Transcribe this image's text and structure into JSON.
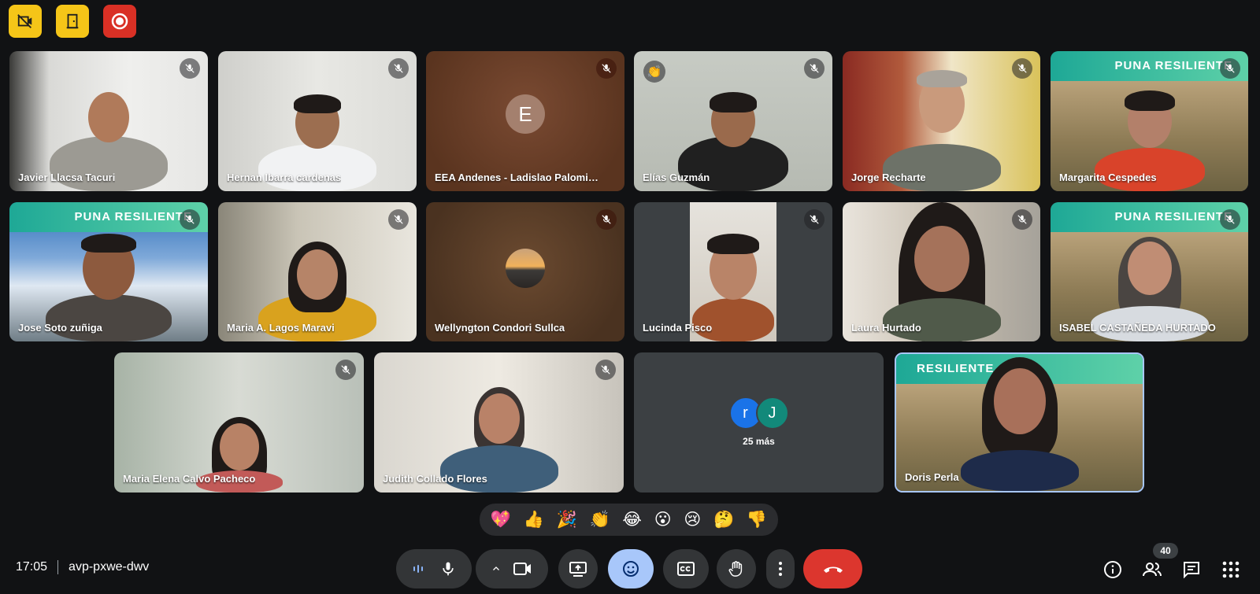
{
  "meeting": {
    "time": "17:05",
    "code": "avp-pxwe-dwv"
  },
  "participants": [
    {
      "name": "Javier Llacsa Tacuri"
    },
    {
      "name": "Hernan Ibarra cardenas"
    },
    {
      "name": "EEA Andenes - Ladislao Palomino F...",
      "initial": "E"
    },
    {
      "name": "Elías Guzmán"
    },
    {
      "name": "Jorge Recharte"
    },
    {
      "name": "Margarita Cespedes",
      "banner": "PUNA RESILIENTE"
    },
    {
      "name": "Jose Soto zuñiga",
      "banner": "PUNA RESILIENTE"
    },
    {
      "name": "Maria A. Lagos Maravi"
    },
    {
      "name": "Wellyngton Condori Sullca"
    },
    {
      "name": "Lucinda Pisco"
    },
    {
      "name": "Laura Hurtado"
    },
    {
      "name": "ISABEL CASTAÑEDA HURTADO",
      "banner": "PUNA RESILIENTE"
    },
    {
      "name": "Maria Elena Calvo Pacheco"
    },
    {
      "name": "Judith Collado Flores"
    },
    {
      "name": "Doris Perla",
      "banner": "RESILIENTE"
    }
  ],
  "more_tile": {
    "initials": [
      "r",
      "J"
    ],
    "label": "25 más"
  },
  "reactions": [
    "💖",
    "👍",
    "🎉",
    "👏",
    "😂",
    "😮",
    "😢",
    "🤔",
    "👎"
  ],
  "people_count": "40",
  "colors": {
    "accent": "#a8c7fa",
    "end_call": "#dc362e",
    "indicator_yellow": "#f5c518",
    "indicator_red": "#d93025"
  }
}
